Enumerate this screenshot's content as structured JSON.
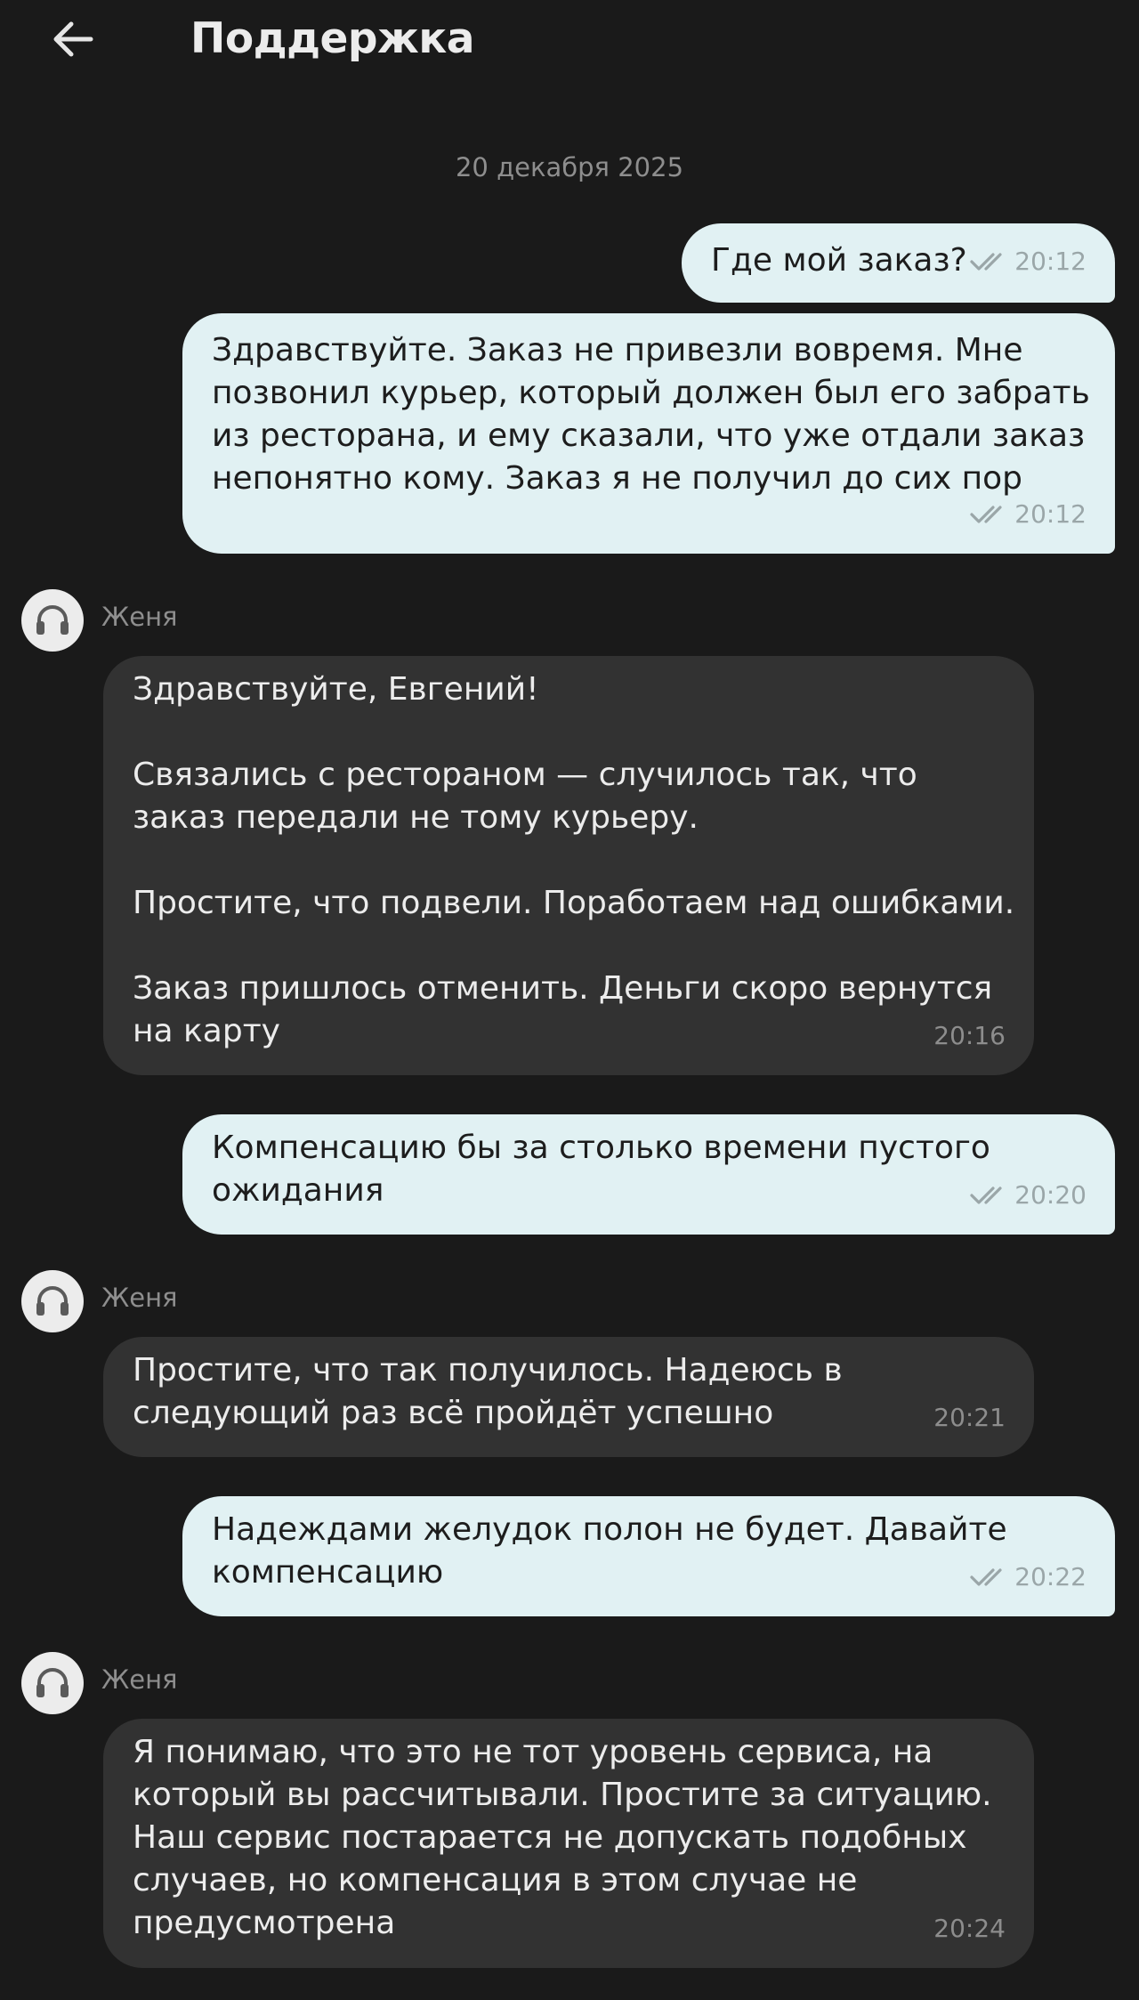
{
  "header": {
    "title": "Поддержка",
    "back_icon": "arrow-left-icon"
  },
  "date_separator": "20 декабря 2025",
  "agent_name": "Женя",
  "messages": [
    {
      "from": "user",
      "text": "Где мой заказ?",
      "time": "20:12",
      "status": "read"
    },
    {
      "from": "user",
      "text": "Здравствуйте. Заказ не привезли вовремя. Мне позвонил курьер, который должен был его забрать из ресторана, и ему сказали, что уже отдали заказ непонятно кому. Заказ я не получил до сих пор",
      "time": "20:12",
      "status": "read"
    },
    {
      "from": "agent",
      "sender": "Женя",
      "text": "Здравствуйте, Евгений!\n\nСвязались с рестораном — случилось так, что заказ передали не тому курьеру.\n\nПростите, что подвели. Поработаем над ошибками.\n\nЗаказ пришлось отменить. Деньги скоро вернутся на карту",
      "time": "20:16"
    },
    {
      "from": "user",
      "text": "Компенсацию бы за столько времени пустого ожидания",
      "time": "20:20",
      "status": "read"
    },
    {
      "from": "agent",
      "sender": "Женя",
      "text": "Простите, что так получилось. Надеюсь в следующий раз всё пройдёт успешно",
      "time": "20:21"
    },
    {
      "from": "user",
      "text": "Надеждами желудок полон не будет. Давайте компенсацию",
      "time": "20:22",
      "status": "read"
    },
    {
      "from": "agent",
      "sender": "Женя",
      "text": "Я понимаю, что это не тот уровень сервиса, на который вы рассчитывали. Простите за ситуацию. Наш сервис постарается не допускать подобных случаев, но компенсация в этом случае не предусмотрена",
      "time": "20:24"
    }
  ],
  "colors": {
    "background": "#1a1a1a",
    "user_bubble": "#e1f1f3",
    "agent_bubble": "#323232",
    "secondary_text": "#8e8e8e"
  },
  "icons": {
    "read_status": "double-check-icon",
    "agent_avatar": "headset-icon"
  }
}
